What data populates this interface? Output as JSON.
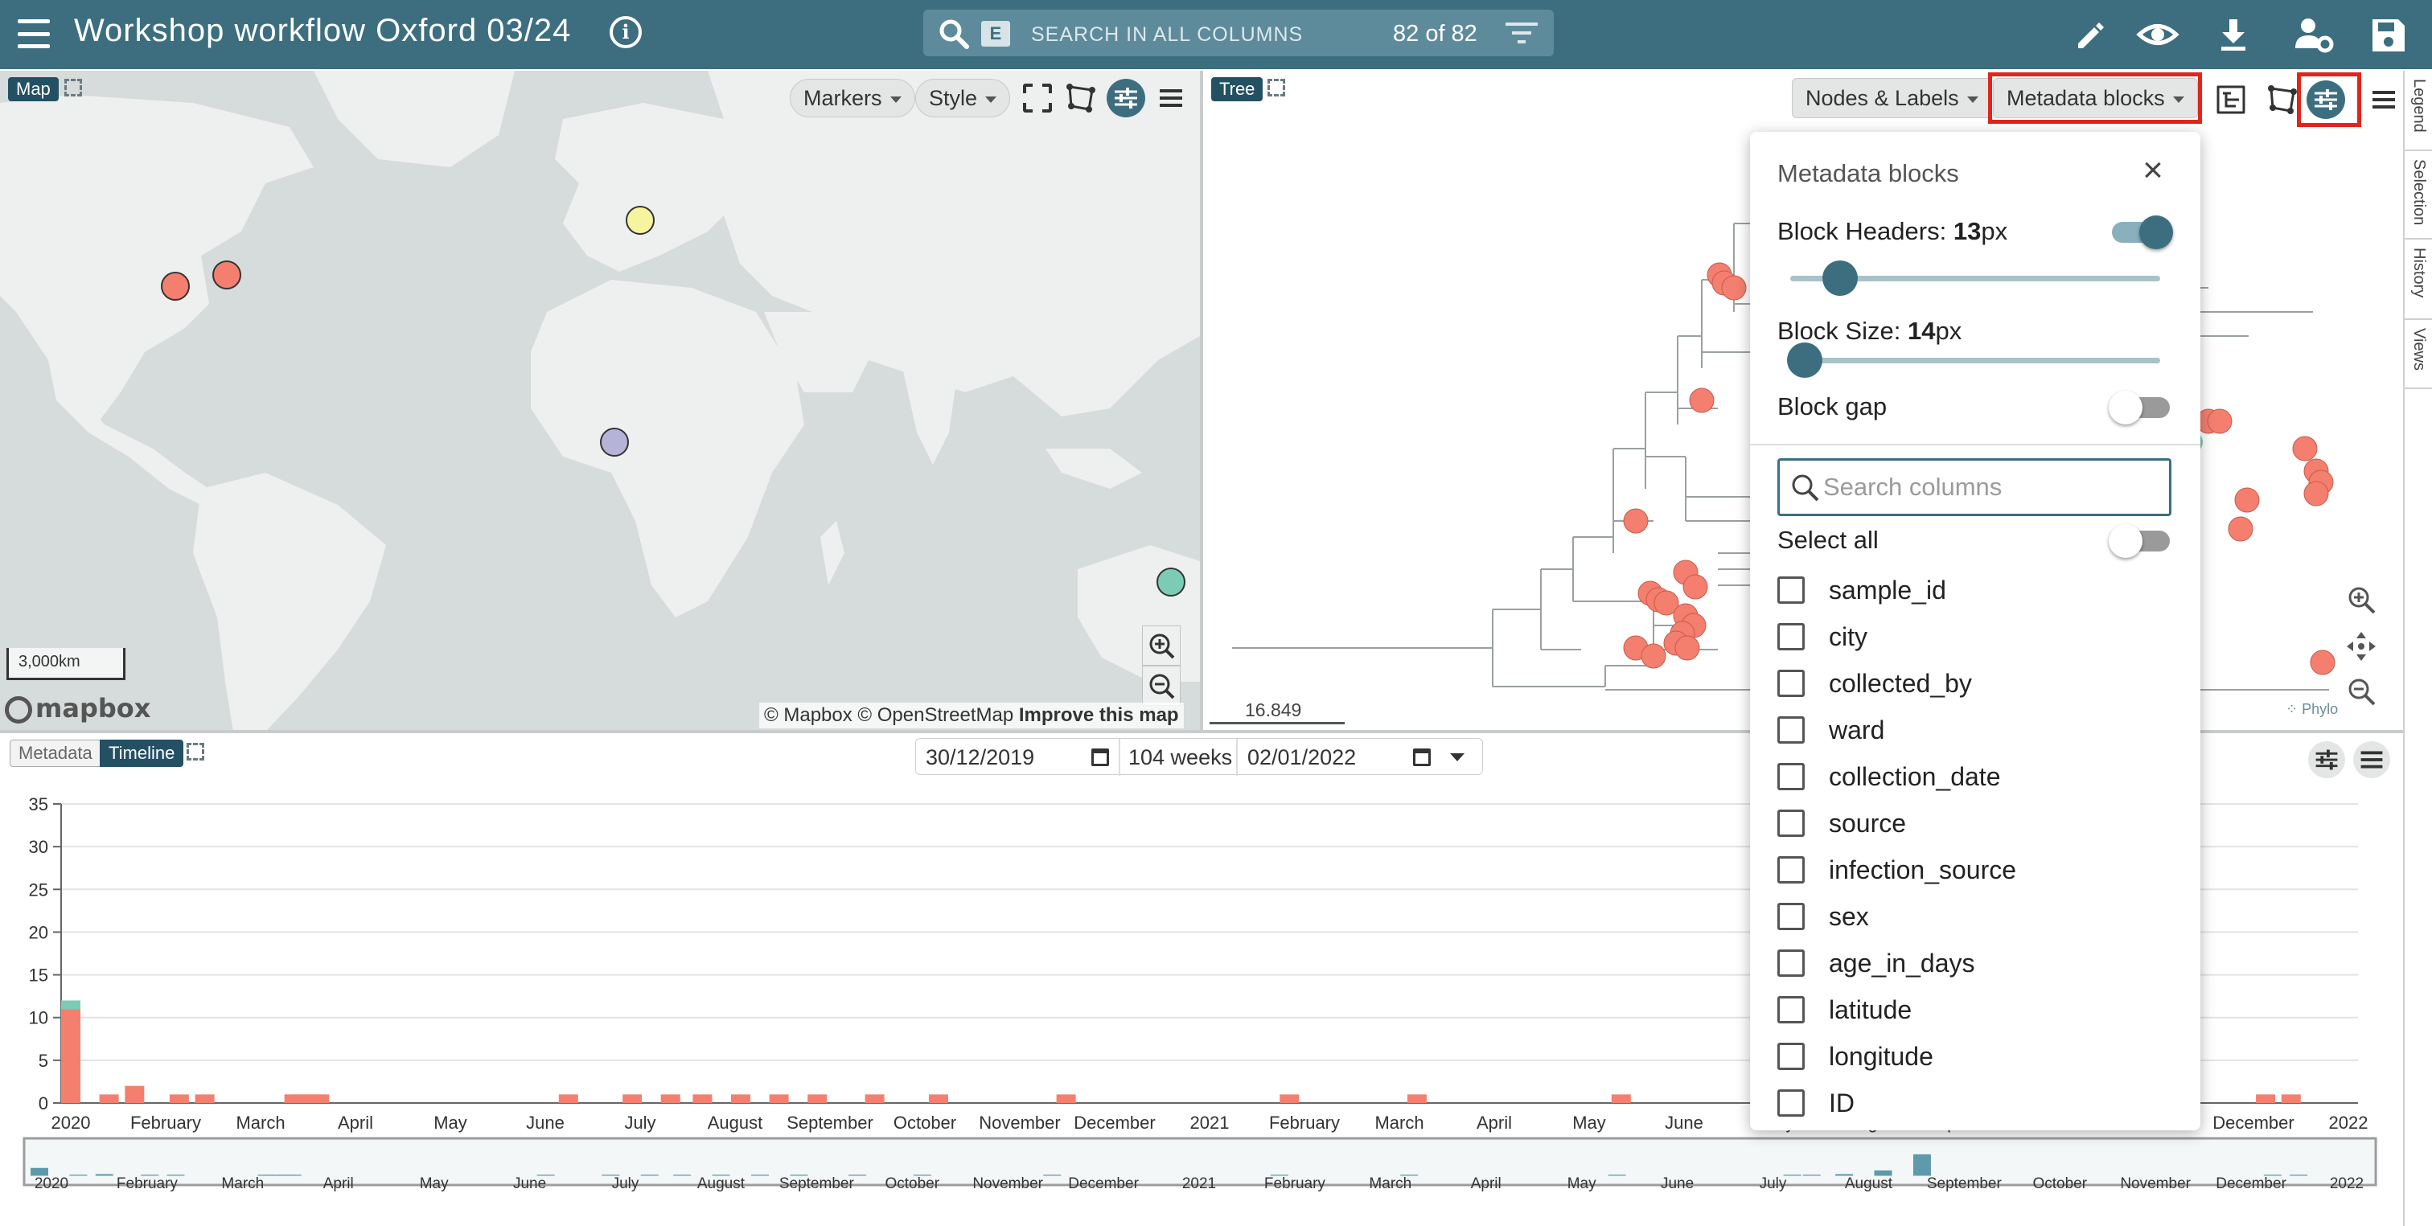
{
  "app": {
    "title": "Workshop workflow Oxford 03/24",
    "search_placeholder": "SEARCH IN ALL COLUMNS",
    "search_key": "E",
    "row_count": "82 of 82",
    "brand_color": "#3c6e80",
    "toolbar_icons": [
      "menu-icon",
      "info-icon",
      "search-icon",
      "filter-icon",
      "pencil-icon",
      "eye-icon",
      "download-icon",
      "user-settings-icon",
      "save-icon"
    ]
  },
  "map": {
    "tag": "Map",
    "markers_label": "Markers",
    "style_label": "Style",
    "scale_label": "3,000km",
    "logo_text": "mapbox",
    "attribution_1": "© Mapbox",
    "attribution_2": "© OpenStreetMap",
    "attribution_3": "Improve this map",
    "marker_colors": [
      "#f47f6f",
      "#f6f49e",
      "#b6b3d8",
      "#7ccbb5"
    ]
  },
  "tree": {
    "tag": "Tree",
    "nodes_labels": "Nodes & Labels",
    "metadata_blocks": "Metadata blocks",
    "scale_value": "16.849",
    "logo_text": "Phylo"
  },
  "side_tabs": [
    "Legend",
    "Selection",
    "History",
    "Views"
  ],
  "metadata_panel": {
    "title": "Metadata blocks",
    "block_headers_label": "Block Headers:",
    "block_headers_value": "13",
    "block_size_label": "Block Size:",
    "block_size_value": "14",
    "unit": "px",
    "block_headers_enabled": true,
    "block_gap_label": "Block gap",
    "block_gap_enabled": false,
    "search_placeholder": "Search columns",
    "select_all_label": "Select all",
    "select_all_enabled": false,
    "columns": [
      "sample_id",
      "city",
      "collected_by",
      "ward",
      "collection_date",
      "source",
      "infection_source",
      "sex",
      "age_in_days",
      "latitude",
      "longitude",
      "ID"
    ]
  },
  "timeline": {
    "tab_metadata": "Metadata",
    "tab_timeline": "Timeline",
    "date_from": "30/12/2019",
    "weeks": "104 weeks",
    "date_to": "02/01/2022"
  },
  "chart_data": {
    "type": "bar",
    "stacked": true,
    "ylim": [
      0,
      35
    ],
    "yticks": [
      0,
      5,
      10,
      15,
      20,
      25,
      30,
      35
    ],
    "grid": true,
    "colors": {
      "red": "#f47f6f",
      "teal": "#7ccbb5",
      "purple": "#b6b3d8",
      "yellow": "#f6f49e"
    },
    "x_labels": [
      "2020",
      "February",
      "March",
      "April",
      "May",
      "June",
      "July",
      "August",
      "September",
      "October",
      "November",
      "December",
      "2021",
      "February",
      "March",
      "April",
      "May",
      "June",
      "July",
      "August",
      "September",
      "October",
      "November",
      "December",
      "2022"
    ],
    "bars": [
      {
        "week": 0,
        "red": 11,
        "teal": 1
      },
      {
        "week": 6,
        "red": 1
      },
      {
        "week": 10,
        "red": 2
      },
      {
        "week": 17,
        "red": 1
      },
      {
        "week": 21,
        "red": 1
      },
      {
        "week": 35,
        "red": 1
      },
      {
        "week": 36,
        "red": 1
      },
      {
        "week": 38,
        "red": 1
      },
      {
        "week": 39,
        "red": 1
      },
      {
        "week": 78,
        "red": 1
      },
      {
        "week": 88,
        "red": 1
      },
      {
        "week": 94,
        "red": 1
      },
      {
        "week": 99,
        "red": 1
      },
      {
        "week": 105,
        "red": 1
      },
      {
        "week": 111,
        "red": 1
      },
      {
        "week": 117,
        "red": 1
      },
      {
        "week": 126,
        "red": 1
      },
      {
        "week": 136,
        "red": 1
      },
      {
        "week": 156,
        "red": 1
      },
      {
        "week": 191,
        "red": 1
      },
      {
        "week": 211,
        "red": 1
      },
      {
        "week": 243,
        "red": 1
      },
      {
        "week": 270,
        "red": 1
      },
      {
        "week": 273,
        "purple": 1
      },
      {
        "week": 278,
        "purple": 2
      },
      {
        "week": 284,
        "purple": 8
      },
      {
        "week": 290,
        "red": 33,
        "yellow": 1
      },
      {
        "week": 344,
        "red": 1
      },
      {
        "week": 348,
        "red": 1
      }
    ],
    "overview_x_labels": [
      "2020",
      "February",
      "March",
      "April",
      "May",
      "June",
      "July",
      "August",
      "September",
      "October",
      "November",
      "December",
      "2021",
      "February",
      "March",
      "April",
      "May",
      "June",
      "July",
      "August",
      "September",
      "October",
      "November",
      "December",
      "2022"
    ]
  }
}
